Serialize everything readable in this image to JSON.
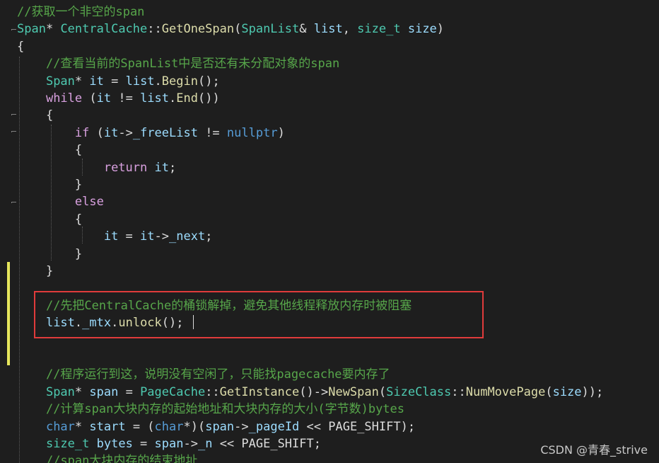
{
  "editor": {
    "lines": [
      [
        {
          "t": "//获取一个非空的span",
          "c": "comment"
        }
      ],
      [
        {
          "t": "Span",
          "c": "type"
        },
        {
          "t": "* ",
          "c": "plain"
        },
        {
          "t": "CentralCache",
          "c": "type"
        },
        {
          "t": "::",
          "c": "plain"
        },
        {
          "t": "GetOneSpan",
          "c": "func"
        },
        {
          "t": "(",
          "c": "plain"
        },
        {
          "t": "SpanList",
          "c": "type"
        },
        {
          "t": "& ",
          "c": "plain"
        },
        {
          "t": "list",
          "c": "var"
        },
        {
          "t": ", ",
          "c": "plain"
        },
        {
          "t": "size_t",
          "c": "type"
        },
        {
          "t": " ",
          "c": "plain"
        },
        {
          "t": "size",
          "c": "var"
        },
        {
          "t": ")",
          "c": "plain"
        }
      ],
      [
        {
          "t": "{",
          "c": "plain"
        }
      ],
      [
        {
          "t": "    ",
          "c": "plain"
        },
        {
          "t": "//查看当前的SpanList中是否还有未分配对象的span",
          "c": "comment"
        }
      ],
      [
        {
          "t": "    ",
          "c": "plain"
        },
        {
          "t": "Span",
          "c": "type"
        },
        {
          "t": "* ",
          "c": "plain"
        },
        {
          "t": "it",
          "c": "var"
        },
        {
          "t": " = ",
          "c": "plain"
        },
        {
          "t": "list",
          "c": "var"
        },
        {
          "t": ".",
          "c": "plain"
        },
        {
          "t": "Begin",
          "c": "func"
        },
        {
          "t": "();",
          "c": "plain"
        }
      ],
      [
        {
          "t": "    ",
          "c": "plain"
        },
        {
          "t": "while",
          "c": "control"
        },
        {
          "t": " (",
          "c": "plain"
        },
        {
          "t": "it",
          "c": "var"
        },
        {
          "t": " != ",
          "c": "plain"
        },
        {
          "t": "list",
          "c": "var"
        },
        {
          "t": ".",
          "c": "plain"
        },
        {
          "t": "End",
          "c": "func"
        },
        {
          "t": "())",
          "c": "plain"
        }
      ],
      [
        {
          "t": "    {",
          "c": "plain"
        }
      ],
      [
        {
          "t": "        ",
          "c": "plain"
        },
        {
          "t": "if",
          "c": "control"
        },
        {
          "t": " (",
          "c": "plain"
        },
        {
          "t": "it",
          "c": "var"
        },
        {
          "t": "->",
          "c": "plain"
        },
        {
          "t": "_freeList",
          "c": "var"
        },
        {
          "t": " != ",
          "c": "plain"
        },
        {
          "t": "nullptr",
          "c": "keyword"
        },
        {
          "t": ")",
          "c": "plain"
        }
      ],
      [
        {
          "t": "        {",
          "c": "plain"
        }
      ],
      [
        {
          "t": "            ",
          "c": "plain"
        },
        {
          "t": "return",
          "c": "control"
        },
        {
          "t": " ",
          "c": "plain"
        },
        {
          "t": "it",
          "c": "var"
        },
        {
          "t": ";",
          "c": "plain"
        }
      ],
      [
        {
          "t": "        }",
          "c": "plain"
        }
      ],
      [
        {
          "t": "        ",
          "c": "plain"
        },
        {
          "t": "else",
          "c": "control"
        }
      ],
      [
        {
          "t": "        {",
          "c": "plain"
        }
      ],
      [
        {
          "t": "            ",
          "c": "plain"
        },
        {
          "t": "it",
          "c": "var"
        },
        {
          "t": " = ",
          "c": "plain"
        },
        {
          "t": "it",
          "c": "var"
        },
        {
          "t": "->",
          "c": "plain"
        },
        {
          "t": "_next",
          "c": "var"
        },
        {
          "t": ";",
          "c": "plain"
        }
      ],
      [
        {
          "t": "        }",
          "c": "plain"
        }
      ],
      [
        {
          "t": "    }",
          "c": "plain"
        }
      ],
      [],
      [
        {
          "t": "    ",
          "c": "plain"
        },
        {
          "t": "//先把CentralCache的桶锁解掉，避免其他线程释放内存时被阻塞",
          "c": "comment"
        }
      ],
      [
        {
          "t": "    ",
          "c": "plain"
        },
        {
          "t": "list",
          "c": "var"
        },
        {
          "t": ".",
          "c": "plain"
        },
        {
          "t": "_mtx",
          "c": "var"
        },
        {
          "t": ".",
          "c": "plain"
        },
        {
          "t": "unlock",
          "c": "func"
        },
        {
          "t": "();",
          "c": "plain"
        }
      ],
      [],
      [],
      [
        {
          "t": "    ",
          "c": "plain"
        },
        {
          "t": "//程序运行到这，说明没有空闲了，只能找pagecache要内存了",
          "c": "comment"
        }
      ],
      [
        {
          "t": "    ",
          "c": "plain"
        },
        {
          "t": "Span",
          "c": "type"
        },
        {
          "t": "* ",
          "c": "plain"
        },
        {
          "t": "span",
          "c": "var"
        },
        {
          "t": " = ",
          "c": "plain"
        },
        {
          "t": "PageCache",
          "c": "type"
        },
        {
          "t": "::",
          "c": "plain"
        },
        {
          "t": "GetInstance",
          "c": "func"
        },
        {
          "t": "()->",
          "c": "plain"
        },
        {
          "t": "NewSpan",
          "c": "func"
        },
        {
          "t": "(",
          "c": "plain"
        },
        {
          "t": "SizeClass",
          "c": "type"
        },
        {
          "t": "::",
          "c": "plain"
        },
        {
          "t": "NumMovePage",
          "c": "func"
        },
        {
          "t": "(",
          "c": "plain"
        },
        {
          "t": "size",
          "c": "var"
        },
        {
          "t": "));",
          "c": "plain"
        }
      ],
      [
        {
          "t": "    ",
          "c": "plain"
        },
        {
          "t": "//计算span大块内存的起始地址和大块内存的大小(字节数)bytes",
          "c": "comment"
        }
      ],
      [
        {
          "t": "    ",
          "c": "plain"
        },
        {
          "t": "char",
          "c": "keyword"
        },
        {
          "t": "* ",
          "c": "plain"
        },
        {
          "t": "start",
          "c": "var"
        },
        {
          "t": " = (",
          "c": "plain"
        },
        {
          "t": "char",
          "c": "keyword"
        },
        {
          "t": "*)(",
          "c": "plain"
        },
        {
          "t": "span",
          "c": "var"
        },
        {
          "t": "->",
          "c": "plain"
        },
        {
          "t": "_pageId",
          "c": "var"
        },
        {
          "t": " << PAGE_SHIFT);",
          "c": "plain"
        }
      ],
      [
        {
          "t": "    ",
          "c": "plain"
        },
        {
          "t": "size_t",
          "c": "type"
        },
        {
          "t": " ",
          "c": "plain"
        },
        {
          "t": "bytes",
          "c": "var"
        },
        {
          "t": " = ",
          "c": "plain"
        },
        {
          "t": "span",
          "c": "var"
        },
        {
          "t": "->",
          "c": "plain"
        },
        {
          "t": "_n",
          "c": "var"
        },
        {
          "t": " << PAGE_SHIFT;",
          "c": "plain"
        }
      ],
      [
        {
          "t": "    ",
          "c": "plain"
        },
        {
          "t": "//span大块内存的结束地址",
          "c": "comment"
        }
      ]
    ],
    "colors": {
      "background": "#1e1e1e",
      "comment": "#57a64a",
      "type": "#4ec9b0",
      "function": "#dcdcaa",
      "keyword": "#569cd6",
      "control": "#d8a0df",
      "variable": "#9cdcfe",
      "plain": "#dcdcdc",
      "highlight_box": "#e03b3b",
      "change_bar": "#e6e65c"
    }
  },
  "watermark": "CSDN @青春_strive"
}
